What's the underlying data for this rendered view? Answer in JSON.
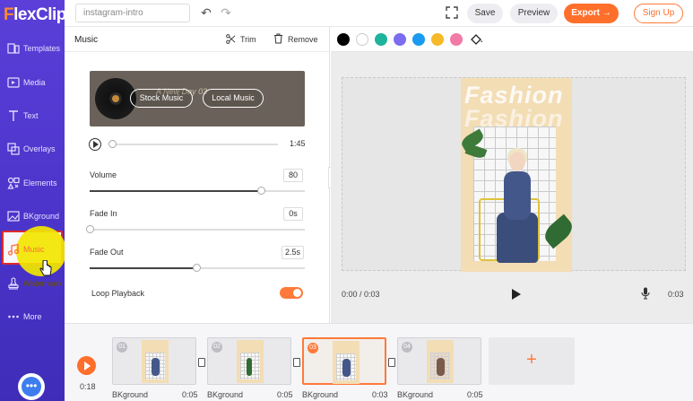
{
  "app": {
    "logo_f": "F",
    "logo_rest": "lexClip"
  },
  "sidebar": {
    "items": [
      {
        "label": "Templates",
        "icon": "templates-icon"
      },
      {
        "label": "Media",
        "icon": "media-icon"
      },
      {
        "label": "Text",
        "icon": "text-icon"
      },
      {
        "label": "Overlays",
        "icon": "overlays-icon"
      },
      {
        "label": "Elements",
        "icon": "elements-icon"
      },
      {
        "label": "BKground",
        "icon": "background-icon"
      },
      {
        "label": "Music",
        "icon": "music-icon"
      },
      {
        "label": "Watermark",
        "icon": "watermark-icon"
      },
      {
        "label": "More",
        "icon": "more-icon"
      }
    ],
    "active": "Music"
  },
  "topbar": {
    "project_name": "instagram-intro",
    "save_label": "Save",
    "preview_label": "Preview",
    "export_label": "Export →",
    "signup_label": "Sign Up"
  },
  "music_panel": {
    "title": "Music",
    "trim_label": "Trim",
    "remove_label": "Remove",
    "card": {
      "track_title": "A New Day 03",
      "stock_music_label": "Stock Music",
      "local_music_label": "Local Music"
    },
    "progress": 0,
    "duration": "1:45",
    "volume": {
      "label": "Volume",
      "value": "80",
      "fraction": 0.8
    },
    "fade_in": {
      "label": "Fade In",
      "value": "0s",
      "fraction": 0
    },
    "fade_out": {
      "label": "Fade Out",
      "value": "2.5s",
      "fraction": 0.5
    },
    "loop": {
      "label": "Loop Playback",
      "enabled": true
    }
  },
  "color_toolbar": {
    "swatches": [
      "#000000",
      "#ffffff",
      "#1eb39b",
      "#7b6cf0",
      "#1a9af0",
      "#f7b927",
      "#f27aa6"
    ]
  },
  "preview": {
    "headline": "Fashion",
    "current_time": "0:00 / 0:03",
    "end_time": "0:03"
  },
  "timeline": {
    "current_time": "0:18",
    "clips": [
      {
        "num": "01",
        "label": "BKground",
        "duration": "0:05"
      },
      {
        "num": "02",
        "label": "BKground",
        "duration": "0:05"
      },
      {
        "num": "03",
        "label": "BKground",
        "duration": "0:03"
      },
      {
        "num": "04",
        "label": "BKground",
        "duration": "0:05"
      }
    ],
    "add_label": "+"
  },
  "colors": {
    "accent": "#ff6f2c",
    "sidebar": "#5b3fd8",
    "highlight": "#e02a2a"
  }
}
